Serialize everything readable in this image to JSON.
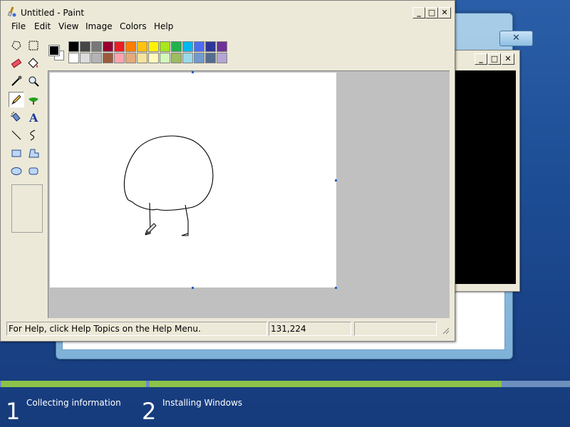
{
  "paint": {
    "title": "Untitled - Paint",
    "menu": [
      "File",
      "Edit",
      "View",
      "Image",
      "Colors",
      "Help"
    ],
    "window_buttons": {
      "minimize": "_",
      "maximize": "□",
      "close": "✕"
    },
    "status": {
      "help_text": "For Help, click Help Topics on the Help Menu.",
      "coordinates": "131,224"
    },
    "tools": [
      "free-form-select",
      "select",
      "eraser",
      "fill-with-color",
      "pick-color",
      "magnifier",
      "pencil",
      "brush",
      "airbrush",
      "text",
      "line",
      "curve",
      "rectangle",
      "polygon",
      "ellipse",
      "rounded-rectangle"
    ],
    "selected_tool": "pencil",
    "palette_row1": [
      "#000000",
      "#464646",
      "#787878",
      "#990030",
      "#ed1c24",
      "#ff7e00",
      "#ffc20e",
      "#fff200",
      "#a8e61d",
      "#22b14c",
      "#00b7ef",
      "#4d6df3",
      "#2f3699",
      "#6f3198"
    ],
    "palette_row2": [
      "#ffffff",
      "#dcdcdc",
      "#b4b4b4",
      "#9c5a3c",
      "#ffa3b1",
      "#e5aa7a",
      "#f5e49c",
      "#fff9bd",
      "#d3f9bc",
      "#9dbb61",
      "#99d9ea",
      "#709ad1",
      "#546d8e",
      "#b5a5d5"
    ],
    "primary_color": "#000000",
    "secondary_color": "#ffffff"
  },
  "cmd_window": {
    "window_buttons": {
      "minimize": "_",
      "maximize": "□",
      "close": "✕"
    }
  },
  "setup": {
    "close_button": "✕",
    "steps": [
      {
        "number": "1",
        "label": "Collecting information"
      },
      {
        "number": "2",
        "label": "Installing Windows"
      }
    ]
  },
  "colors": {
    "progress_fill": "#8bc34a",
    "progress_track": "#6c8fbe"
  }
}
